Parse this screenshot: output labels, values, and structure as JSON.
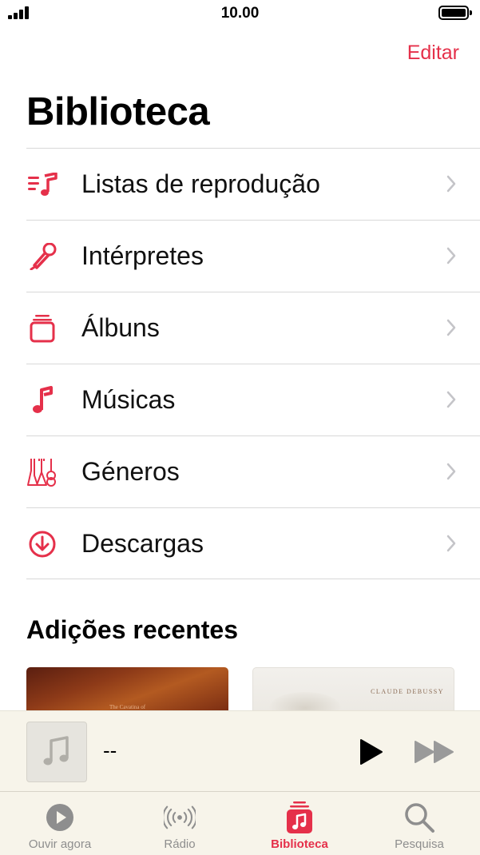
{
  "status": {
    "time": "10.00"
  },
  "header": {
    "edit_label": "Editar",
    "title": "Biblioteca"
  },
  "menu": {
    "items": [
      {
        "label": "Listas de reprodução",
        "icon": "playlist-icon"
      },
      {
        "label": "Intérpretes",
        "icon": "microphone-icon"
      },
      {
        "label": "Álbuns",
        "icon": "album-stack-icon"
      },
      {
        "label": "Músicas",
        "icon": "music-note-icon"
      },
      {
        "label": "Géneros",
        "icon": "guitars-icon"
      },
      {
        "label": "Descargas",
        "icon": "download-circle-icon"
      }
    ]
  },
  "recent": {
    "title": "Adições recentes",
    "albums": [
      {
        "cover_text": "The Cavatina of"
      },
      {
        "cover_text": "CLAUDE DEBUSSY"
      }
    ]
  },
  "player": {
    "title": "--"
  },
  "tabs": [
    {
      "label": "Ouvir agora",
      "icon": "play-circle-icon",
      "active": false
    },
    {
      "label": "Rádio",
      "icon": "radio-waves-icon",
      "active": false
    },
    {
      "label": "Biblioteca",
      "icon": "library-icon",
      "active": true
    },
    {
      "label": "Pesquisa",
      "icon": "search-icon",
      "active": false
    }
  ],
  "colors": {
    "accent": "#e5304a",
    "tab_inactive": "#8e8e8e",
    "player_bg": "#f7f4ea"
  }
}
